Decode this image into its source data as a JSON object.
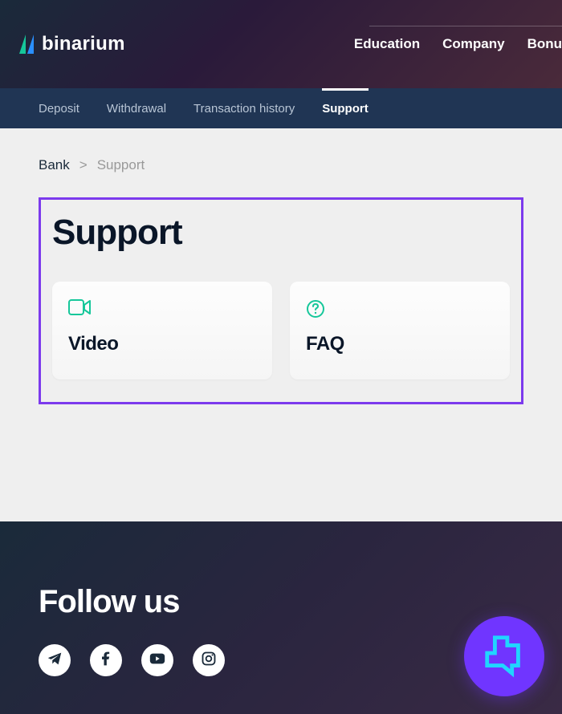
{
  "brand": {
    "name": "binarium"
  },
  "topnav": {
    "items": [
      {
        "label": "Education"
      },
      {
        "label": "Company"
      },
      {
        "label": "Bonu"
      }
    ]
  },
  "subnav": {
    "items": [
      {
        "label": "Deposit",
        "active": false
      },
      {
        "label": "Withdrawal",
        "active": false
      },
      {
        "label": "Transaction history",
        "active": false
      },
      {
        "label": "Support",
        "active": true
      }
    ]
  },
  "breadcrumb": {
    "root": "Bank",
    "separator": ">",
    "current": "Support"
  },
  "page": {
    "title": "Support"
  },
  "cards": [
    {
      "title": "Video",
      "icon": "video"
    },
    {
      "title": "FAQ",
      "icon": "question"
    }
  ],
  "footer": {
    "follow_title": "Follow us",
    "socials": [
      {
        "name": "telegram"
      },
      {
        "name": "facebook"
      },
      {
        "name": "youtube"
      },
      {
        "name": "instagram"
      }
    ]
  },
  "colors": {
    "accent_icon": "#16c79a",
    "highlight_border": "#7c3aed",
    "chat_bg": "#7035ff",
    "chat_icon": "#20d5ff"
  }
}
